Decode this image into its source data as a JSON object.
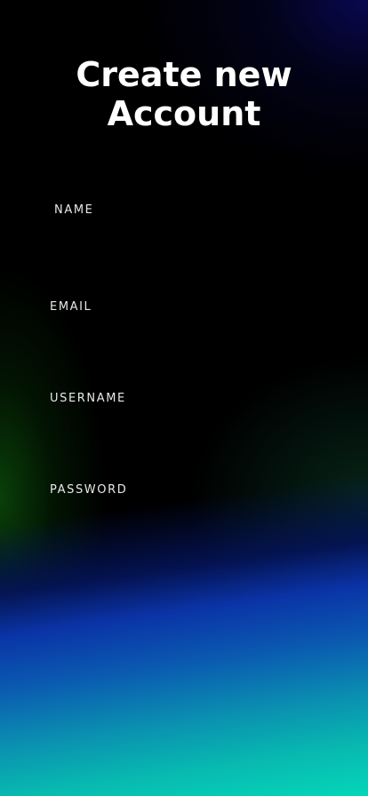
{
  "screen": {
    "title": "Create new Account"
  },
  "form": {
    "name_label": "NAME",
    "email_label": "EMAIL",
    "username_label": "USERNAME",
    "password_label": "PASSWORD"
  },
  "colors": {
    "background": "#000000",
    "text": "#ffffff",
    "gradient_blue": "#0a33a6",
    "gradient_teal": "#04d6b8",
    "gradient_green": "#0a460a",
    "gradient_navy": "#0a0a5f"
  }
}
